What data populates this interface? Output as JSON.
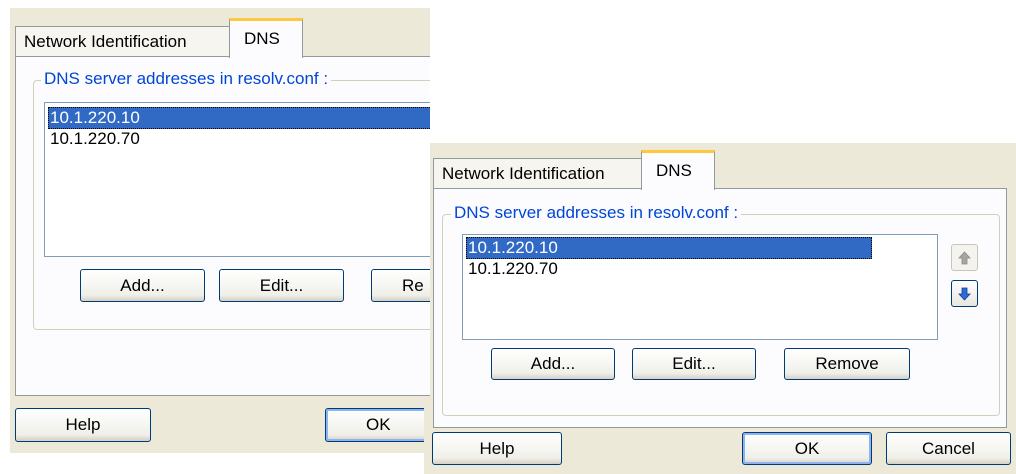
{
  "back_dialog": {
    "tabs": [
      {
        "label": "Network Identification"
      },
      {
        "label": "DNS"
      }
    ],
    "group_label": "DNS server addresses in resolv.conf :",
    "dns_list": [
      {
        "address": "10.1.220.10"
      },
      {
        "address": "10.1.220.70"
      }
    ],
    "buttons": {
      "add": "Add...",
      "edit": "Edit...",
      "remove": "Re"
    },
    "footer": {
      "help": "Help",
      "ok": "OK"
    }
  },
  "front_dialog": {
    "tabs": [
      {
        "label": "Network Identification"
      },
      {
        "label": "DNS"
      }
    ],
    "group_label": "DNS server addresses in resolv.conf :",
    "dns_list": [
      {
        "address": "10.1.220.10"
      },
      {
        "address": "10.1.220.70"
      }
    ],
    "buttons": {
      "add": "Add...",
      "edit": "Edit...",
      "remove": "Remove"
    },
    "footer": {
      "help": "Help",
      "ok": "OK",
      "cancel": "Cancel"
    }
  },
  "icons": {
    "move_up": "up-arrow-icon",
    "move_down": "down-arrow-icon"
  },
  "colors": {
    "selection": "#316ac5",
    "group_label": "#0046d5",
    "active_tab_accent": "#ffc83c",
    "button_border": "#003c74"
  }
}
